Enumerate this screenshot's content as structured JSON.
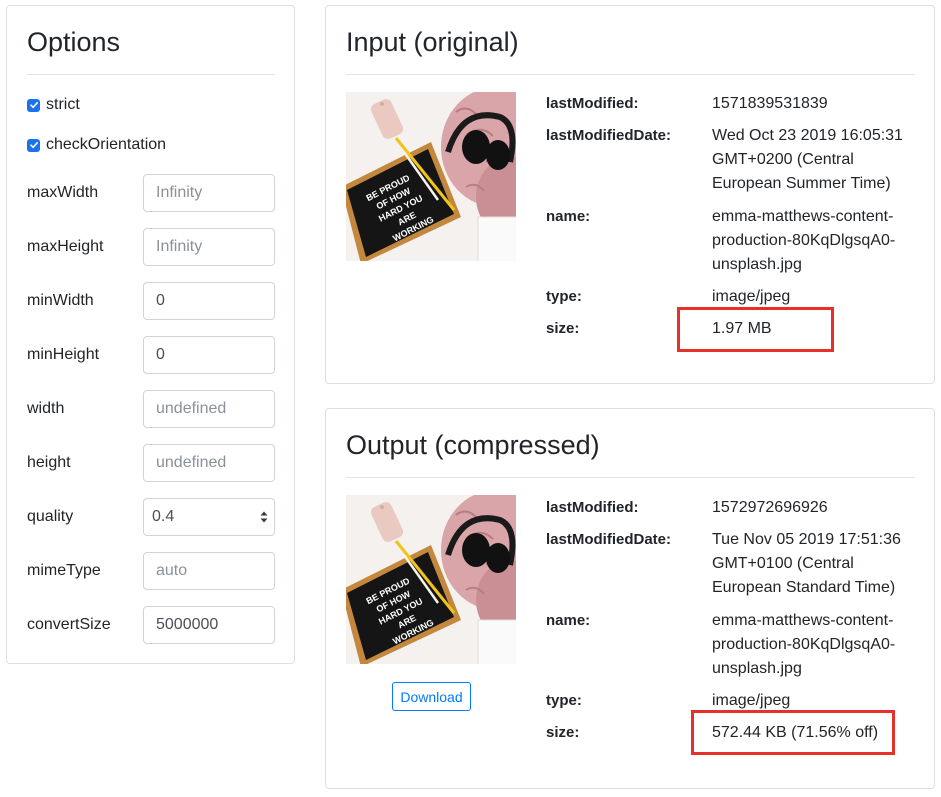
{
  "options": {
    "title": "Options",
    "checks": [
      {
        "label": "strict",
        "checked": true
      },
      {
        "label": "checkOrientation",
        "checked": true
      }
    ],
    "fields": [
      {
        "label": "maxWidth",
        "value": "",
        "placeholder": "Infinity"
      },
      {
        "label": "maxHeight",
        "value": "",
        "placeholder": "Infinity"
      },
      {
        "label": "minWidth",
        "value": "0",
        "placeholder": ""
      },
      {
        "label": "minHeight",
        "value": "0",
        "placeholder": ""
      },
      {
        "label": "width",
        "value": "",
        "placeholder": "undefined"
      },
      {
        "label": "height",
        "value": "",
        "placeholder": "undefined"
      },
      {
        "label": "quality",
        "value": "0.4",
        "placeholder": "",
        "type": "select"
      },
      {
        "label": "mimeType",
        "value": "",
        "placeholder": "auto"
      },
      {
        "label": "convertSize",
        "value": "5000000",
        "placeholder": ""
      }
    ]
  },
  "input": {
    "title": "Input (original)",
    "image_alt": "Letter board reading BE PROUD OF HOW HARD YOU ARE WORKING with headphones on pink fur",
    "labels": {
      "lastModified": "lastModified:",
      "lastModifiedDate": "lastModifiedDate:",
      "name": "name:",
      "type": "type:",
      "size": "size:"
    },
    "lastModified": "1571839531839",
    "lastModifiedDate": [
      "Wed Oct 23 2019 16:05:31",
      "GMT+0200 (Central",
      "European Summer Time)"
    ],
    "name": [
      "emma-matthews-content-",
      "production-80KqDlgsqA0-",
      "unsplash.jpg"
    ],
    "type": "image/jpeg",
    "size": "1.97 MB"
  },
  "output": {
    "title": "Output (compressed)",
    "image_alt": "Letter board reading BE PROUD OF HOW HARD YOU ARE WORKING with headphones on pink fur",
    "download_label": "Download",
    "labels": {
      "lastModified": "lastModified:",
      "lastModifiedDate": "lastModifiedDate:",
      "name": "name:",
      "type": "type:",
      "size": "size:"
    },
    "lastModified": "1572972696926",
    "lastModifiedDate": [
      "Tue Nov 05 2019 17:51:36",
      "GMT+0100 (Central",
      "European Standard Time)"
    ],
    "name": [
      "emma-matthews-content-",
      "production-80KqDlgsqA0-",
      "unsplash.jpg"
    ],
    "type": "image/jpeg",
    "size": "572.44 KB (71.56% off)"
  },
  "board_text": [
    "BE PROUD",
    "OF HOW",
    "HARD YOU",
    "ARE",
    "WORKING"
  ],
  "colors": {
    "accent": "#007bff",
    "checkbox": "#1a73e8",
    "highlight": "#e8302b",
    "border": "#dfdfdf"
  }
}
